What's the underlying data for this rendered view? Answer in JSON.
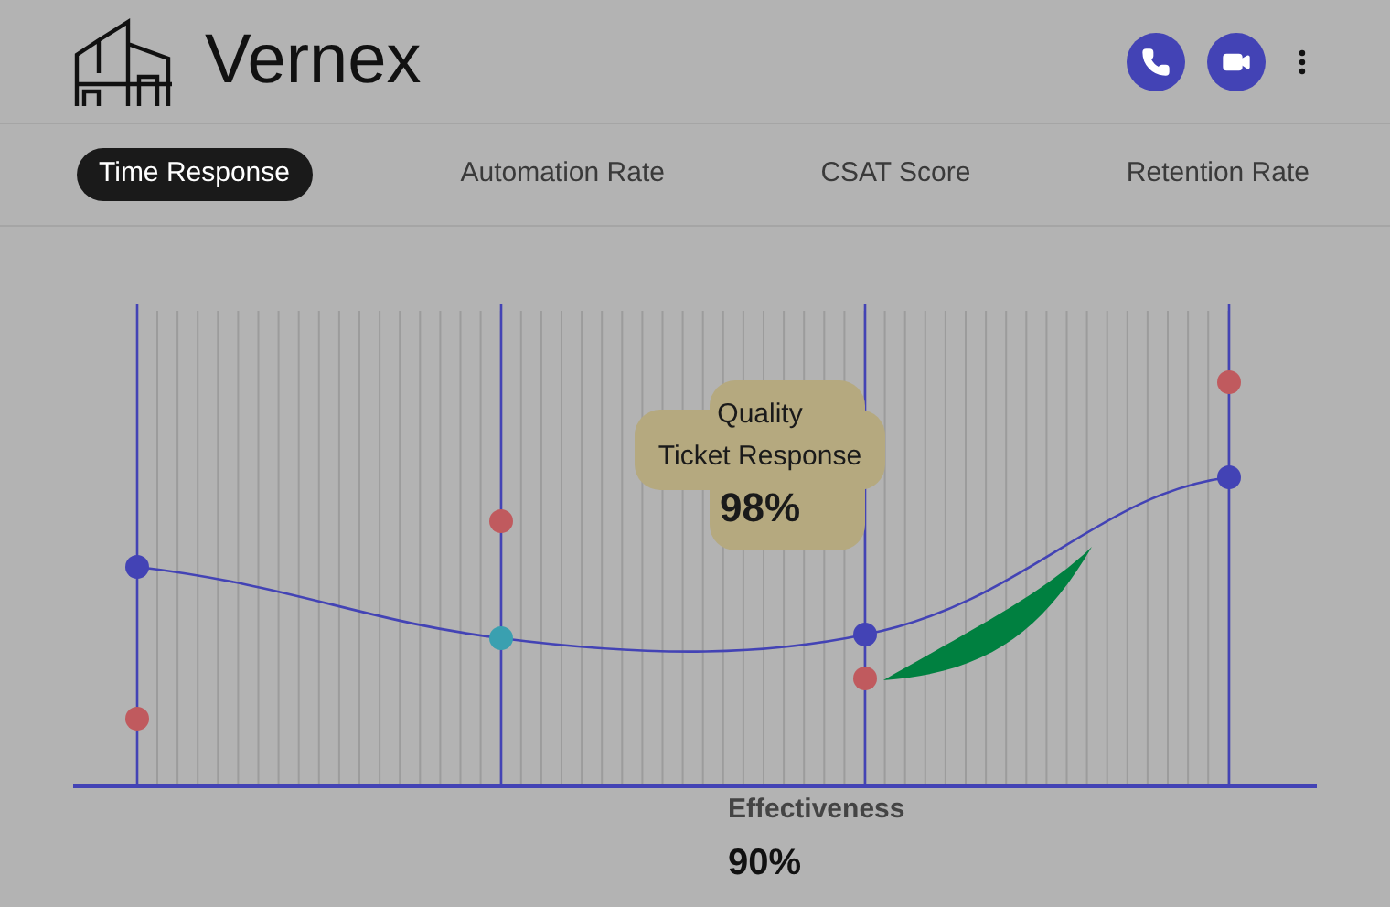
{
  "app": {
    "name": "Vernex"
  },
  "tabs": [
    {
      "label": "Time Response",
      "selected": true
    },
    {
      "label": "Automation Rate",
      "selected": false
    },
    {
      "label": "CSAT Score",
      "selected": false
    },
    {
      "label": "Retention Rate",
      "selected": false
    }
  ],
  "tooltip": {
    "title_line_1": "Quality",
    "title_line_2": "Ticket Response",
    "value": "98%"
  },
  "summary": {
    "label": "Effectiveness",
    "value": "90%"
  }
}
